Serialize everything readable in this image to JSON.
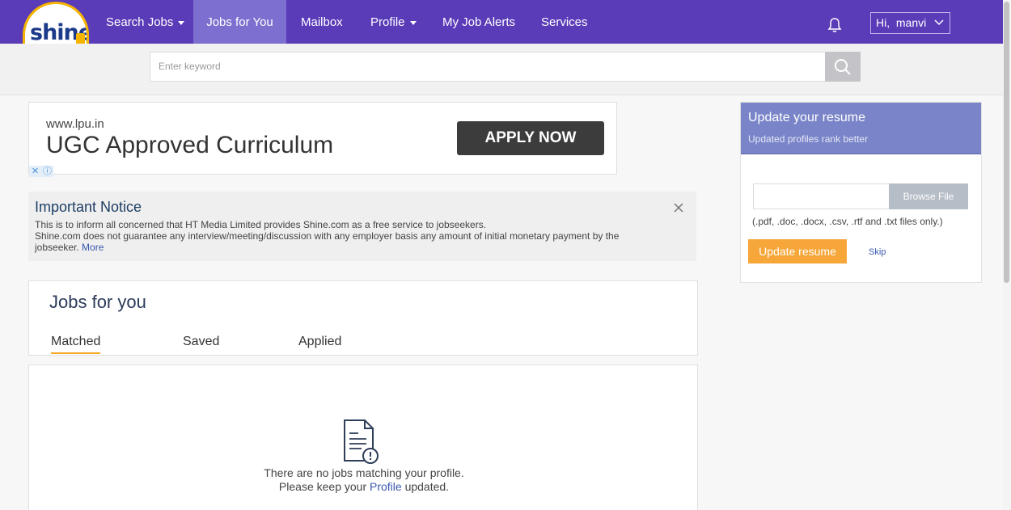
{
  "logo": {
    "text": "shine",
    "domain_badge": ".com"
  },
  "nav": {
    "items": [
      {
        "label": "Search Jobs",
        "dropdown": true
      },
      {
        "label": "Jobs for You",
        "active": true
      },
      {
        "label": "Mailbox"
      },
      {
        "label": "Profile",
        "dropdown": true
      },
      {
        "label": "My Job Alerts"
      },
      {
        "label": "Services"
      }
    ],
    "greeting": "Hi,  manvi"
  },
  "search": {
    "placeholder": "Enter keyword"
  },
  "ad": {
    "url": "www.lpu.in",
    "title": "UGC Approved Curriculum",
    "cta": "APPLY NOW"
  },
  "notice": {
    "title": "Important Notice",
    "line1": "This is to inform all concerned that HT Media Limited provides Shine.com as a free service to jobseekers.",
    "line2": "Shine.com does not guarantee any interview/meeting/discussion with any employer basis any amount of initial monetary payment by the jobseeker.",
    "more": "More"
  },
  "jobs": {
    "title": "Jobs for you",
    "tabs": [
      "Matched",
      "Saved",
      "Applied"
    ],
    "empty_line1": "There are no jobs matching your profile.",
    "empty_line2_prefix": "Please keep your",
    "empty_link": "Profile",
    "empty_line2_suffix": "updated."
  },
  "resume": {
    "title": "Update your resume",
    "subtitle": "Updated profiles rank better",
    "browse": "Browse File",
    "note": "(.pdf, .doc, .docx, .csv, .rtf and .txt files only.)",
    "update": "Update resume",
    "skip": "Skip"
  },
  "colors": {
    "nav_bg": "#5a3bb8",
    "nav_active": "#7d6fcf",
    "resume_header": "#7985c8",
    "cta_orange": "#f7a63a",
    "link_blue": "#3a57b0"
  }
}
